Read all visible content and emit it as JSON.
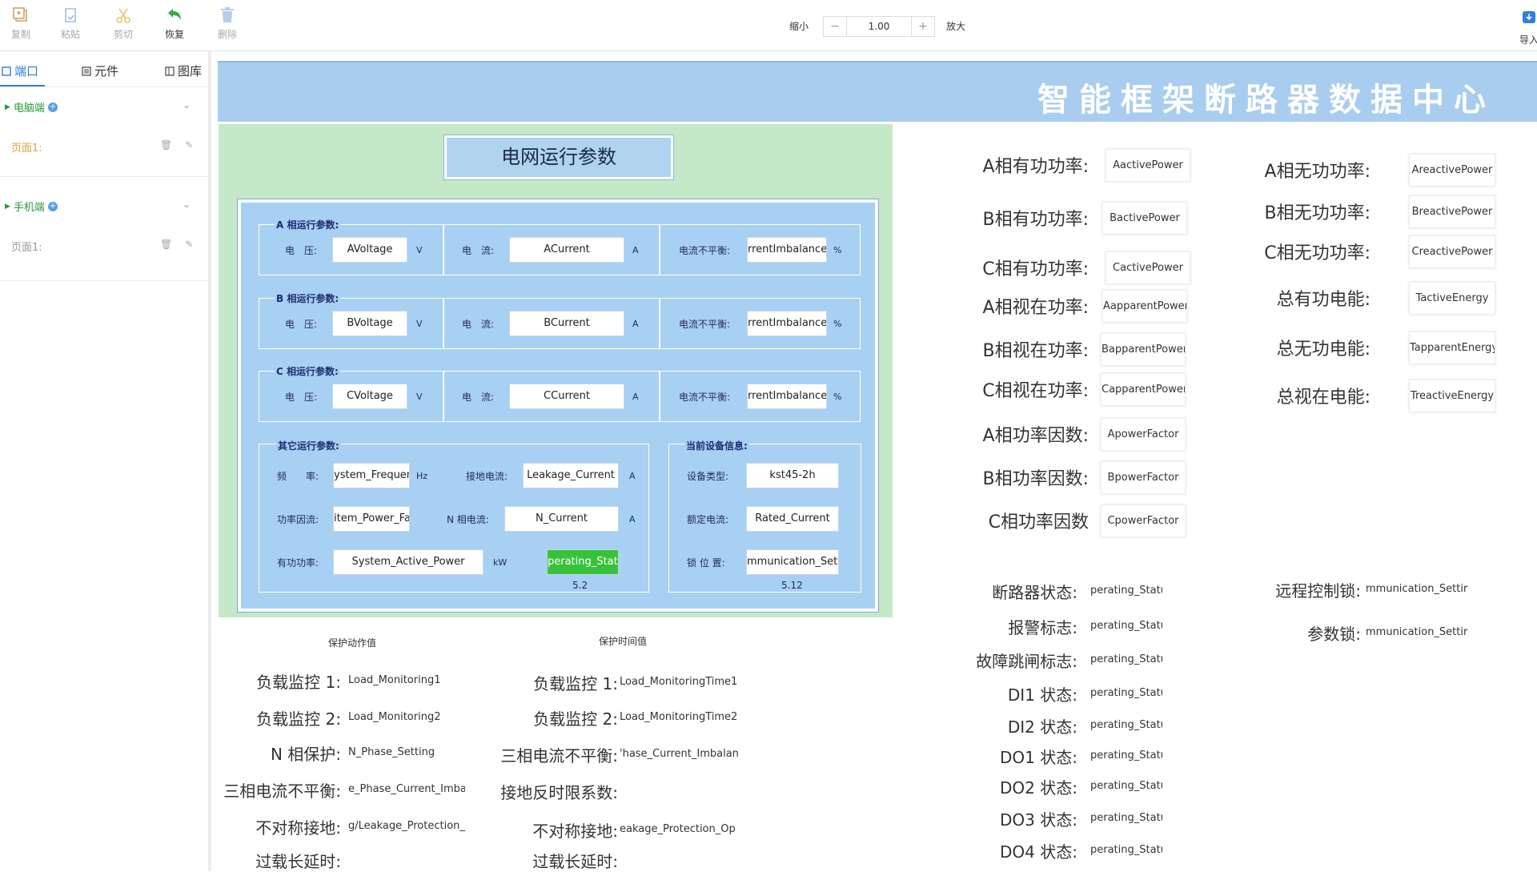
{
  "toolbar": {
    "copy": "复制",
    "paste": "粘贴",
    "cut": "剪切",
    "undo": "恢复",
    "delete": "删除",
    "zoom_out": "缩小",
    "zoom_value": "1.00",
    "zoom_in": "放大",
    "import": "导入",
    "minus": "−",
    "plus": "+"
  },
  "sidebar": {
    "tabs": [
      "端口",
      "元件",
      "图库"
    ],
    "groups": [
      {
        "name": "电脑端",
        "page": "页面1:"
      },
      {
        "name": "手机端",
        "page": "页面1:"
      }
    ]
  },
  "header": {
    "title": "智能框架断路器数据中心"
  },
  "grid": {
    "title": "电网运行参数",
    "phases": [
      {
        "title": "A 相运行参数:",
        "voltage_label": "电　压:",
        "voltage": "AVoltage",
        "v_unit": "V",
        "current_label": "电　流:",
        "current": "ACurrent",
        "a_unit": "A",
        "imb_label": "电流不平衡:",
        "imb": "rrentImbalanceF",
        "pct": "%"
      },
      {
        "title": "B 相运行参数:",
        "voltage_label": "电　压:",
        "voltage": "BVoltage",
        "v_unit": "V",
        "current_label": "电　流:",
        "current": "BCurrent",
        "a_unit": "A",
        "imb_label": "电流不平衡:",
        "imb": "rrentImbalanceF",
        "pct": "%"
      },
      {
        "title": "C 相运行参数:",
        "voltage_label": "电　压:",
        "voltage": "CVoltage",
        "v_unit": "V",
        "current_label": "电　流:",
        "current": "CCurrent",
        "a_unit": "A",
        "imb_label": "电流不平衡:",
        "imb": "rrentImbalanceF",
        "pct": "%"
      }
    ],
    "other": {
      "title": "其它运行参数:",
      "freq_label": "频　　率:",
      "freq": "ystem_Frequenc",
      "hz": "Hz",
      "leak_label": "接地电流:",
      "leak": "Leakage_Current",
      "a1": "A",
      "pf_label": "功率因流:",
      "pf": "item_Power_Fac",
      "n_label": "N 相电流:",
      "n": "N_Current",
      "a2": "A",
      "ap_label": "有功功率:",
      "ap": "System_Active_Power",
      "kw": "kW",
      "op": "perating_Statu",
      "op_sub": "5.2"
    },
    "device": {
      "title": "当前设备信息:",
      "type_label": "设备类型:",
      "type": "kst45-2h",
      "rated_label": "额定电流:",
      "rated": "Rated_Current",
      "lock_label": "锁 位 置:",
      "lock": "mmunication_Settir",
      "lock_sub": "5.12"
    }
  },
  "power_left": [
    {
      "label": "A相有功功率:",
      "value": "AactivePower"
    },
    {
      "label": "B相有功功率:",
      "value": "BactivePower"
    },
    {
      "label": "C相有功功率:",
      "value": "CactivePower"
    },
    {
      "label": "A相视在功率:",
      "value": "AapparentPower"
    },
    {
      "label": "B相视在功率:",
      "value": "BapparentPower"
    },
    {
      "label": "C相视在功率:",
      "value": "CapparentPower"
    },
    {
      "label": "A相功率因数:",
      "value": "ApowerFactor"
    },
    {
      "label": "B相功率因数:",
      "value": "BpowerFactor"
    },
    {
      "label": "C相功率因数",
      "value": "CpowerFactor"
    }
  ],
  "power_right": [
    {
      "label": "A相无功功率:",
      "value": "AreactivePower"
    },
    {
      "label": "B相无功功率:",
      "value": "BreactivePower"
    },
    {
      "label": "C相无功功率:",
      "value": "CreactivePower"
    },
    {
      "label": "总有功电能:",
      "value": "TactiveEnergy"
    },
    {
      "label": "总无功电能:",
      "value": "TapparentEnergy"
    },
    {
      "label": "总视在电能:",
      "value": "TreactiveEnergy"
    }
  ],
  "status_left": [
    {
      "label": "断路器状态:",
      "value": "perating_Statu"
    },
    {
      "label": "报警标志:",
      "value": "perating_Statu"
    },
    {
      "label": "故障跳闸标志:",
      "value": "perating_Statu"
    },
    {
      "label": "DI1 状态:",
      "value": "perating_Statu"
    },
    {
      "label": "DI2 状态:",
      "value": "perating_Statu"
    },
    {
      "label": "DO1 状态:",
      "value": "perating_Statu"
    },
    {
      "label": "DO2 状态:",
      "value": "perating_Statu"
    },
    {
      "label": "DO3 状态:",
      "value": "perating_Statu"
    },
    {
      "label": "DO4 状态:",
      "value": "perating_Statu"
    }
  ],
  "status_right": [
    {
      "label": "远程控制锁:",
      "value": "mmunication_Settir"
    },
    {
      "label": "参数锁:",
      "value": "mmunication_Settir"
    }
  ],
  "protection": {
    "action_header": "保护动作值",
    "time_header": "保护时间值",
    "action": [
      {
        "label": "负载监控 1:",
        "value": "Load_Monitoring1"
      },
      {
        "label": "负载监控 2:",
        "value": "Load_Monitoring2"
      },
      {
        "label": "N 相保护:",
        "value": "N_Phase_Setting"
      },
      {
        "label": "三相电流不平衡:",
        "value": "e_Phase_Current_Imbal"
      },
      {
        "label": "不对称接地:",
        "value": "g/Leakage_Protection_("
      },
      {
        "label": "过载长延时:",
        "value": ""
      }
    ],
    "time": [
      {
        "label": "负载监控 1:",
        "value": "Load_MonitoringTime1"
      },
      {
        "label": "负载监控 2:",
        "value": "Load_MonitoringTime2"
      },
      {
        "label": "三相电流不平衡:",
        "value": "'hase_Current_Imbalan"
      },
      {
        "label": "接地反时限系数:",
        "value": ""
      },
      {
        "label": "不对称接地:",
        "value": "eakage_Protection_Op"
      },
      {
        "label": "过载长延时:",
        "value": ""
      }
    ]
  }
}
